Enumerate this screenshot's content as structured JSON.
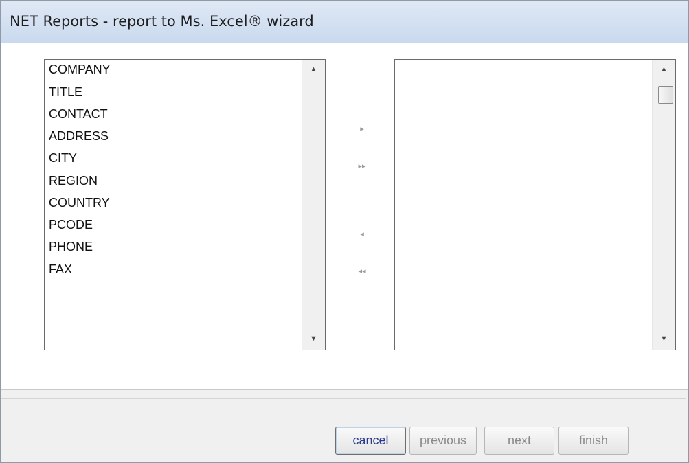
{
  "window": {
    "title": "NET Reports - report to Ms. Excel® wizard"
  },
  "left_list": {
    "items": [
      "COMPANY",
      "TITLE",
      "CONTACT",
      "ADDRESS",
      "CITY",
      "REGION",
      "COUNTRY",
      "PCODE",
      "PHONE",
      "FAX"
    ]
  },
  "right_list": {
    "items": []
  },
  "transfer": {
    "move_right": "▸",
    "move_all_right": "▸▸",
    "move_left": "◂",
    "move_all_left": "◂◂"
  },
  "scroll": {
    "up": "▲",
    "down": "▼"
  },
  "buttons": {
    "cancel": "cancel",
    "previous": "previous",
    "next": "next",
    "finish": "finish"
  }
}
